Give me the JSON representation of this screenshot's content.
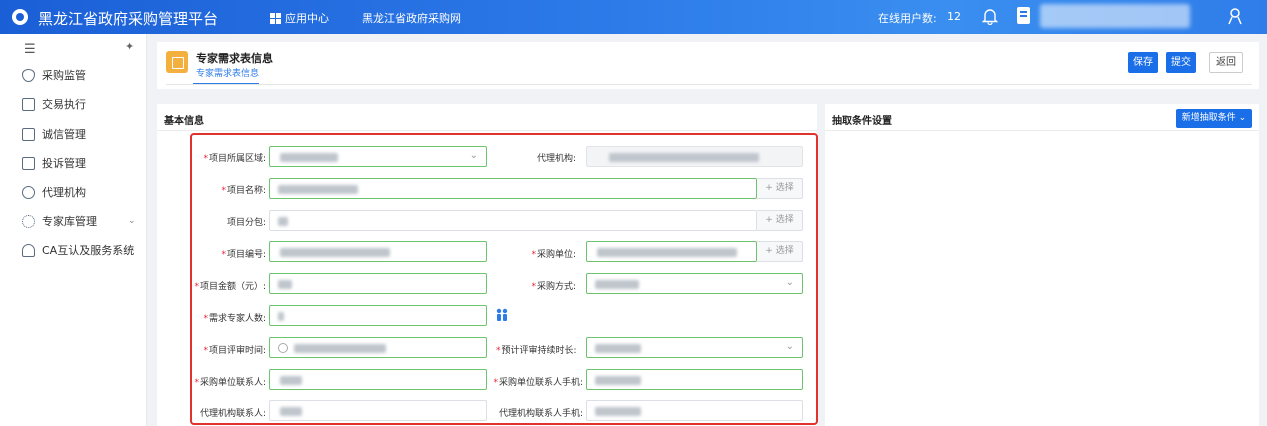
{
  "topbar": {
    "title": "黑龙江省政府采购管理平台",
    "app_center": "应用中心",
    "portal": "黑龙江省政府采购网",
    "online_label": "在线用户数:",
    "online_count": "12"
  },
  "sidebar": {
    "items": [
      {
        "label": "采购监管"
      },
      {
        "label": "交易执行"
      },
      {
        "label": "诚信管理"
      },
      {
        "label": "投诉管理"
      },
      {
        "label": "代理机构"
      },
      {
        "label": "专家库管理"
      },
      {
        "label": "CA互认及服务系统"
      }
    ]
  },
  "header": {
    "title": "专家需求表信息",
    "tab": "专家需求表信息",
    "save": "保存",
    "submit": "提交",
    "back": "返回"
  },
  "basic": {
    "title": "基本信息",
    "fields": {
      "region": "项目所属区域:",
      "agency": "代理机构:",
      "project_name": "项目名称:",
      "sub_package": "项目分包:",
      "project_no": "项目编号:",
      "purchaser": "采购单位:",
      "amount": "项目金额（元）:",
      "method": "采购方式:",
      "experts": "需求专家人数:",
      "review_time": "项目评审时间:",
      "duration": "预计评审持续时长:",
      "purchaser_contact": "采购单位联系人:",
      "purchaser_phone": "采购单位联系人手机:",
      "agency_contact": "代理机构联系人:",
      "agency_phone": "代理机构联系人手机:"
    },
    "select_label": "+ 选择"
  },
  "conditions": {
    "title": "抽取条件设置",
    "add_button": "新增抽取条件"
  },
  "colors": {
    "primary": "#1a6ee8",
    "topbar": "#2b78e8",
    "required": "#e23333",
    "valid_border": "#6cc46c",
    "highlight": "#e0332e"
  }
}
